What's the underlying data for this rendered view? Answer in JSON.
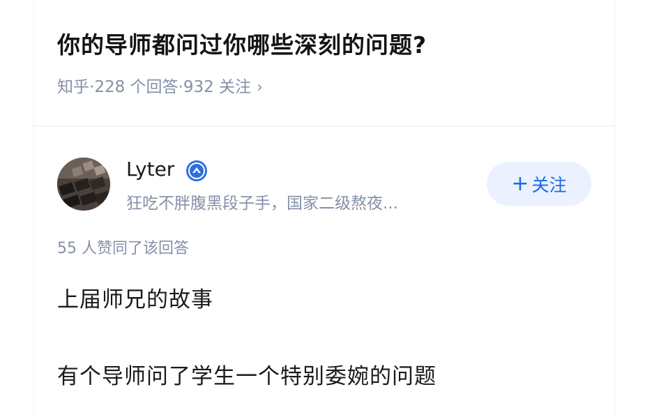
{
  "question": {
    "title": "你的导师都问过你哪些深刻的问题?",
    "meta": {
      "source": "知乎",
      "sep1": " · ",
      "answers": "228 个回答",
      "sep2": " · ",
      "followers": "932 关注",
      "chevron": "›"
    }
  },
  "answer": {
    "author": {
      "name": "Lyter",
      "badge_icon": "verified-badge-icon",
      "bio": "狂吃不胖腹黑段子手，国家二级熬夜...",
      "follow_plus": "+",
      "follow_label": "关注"
    },
    "vote_text": "55 人赞同了该回答",
    "paragraphs": [
      "上届师兄的故事",
      "有个导师问了学生一个特别委婉的问题"
    ]
  },
  "colors": {
    "accent": "#1769e6",
    "follow_bg": "#ebf1fe",
    "meta_gray": "#8590a6",
    "text": "#1a1a1a"
  }
}
